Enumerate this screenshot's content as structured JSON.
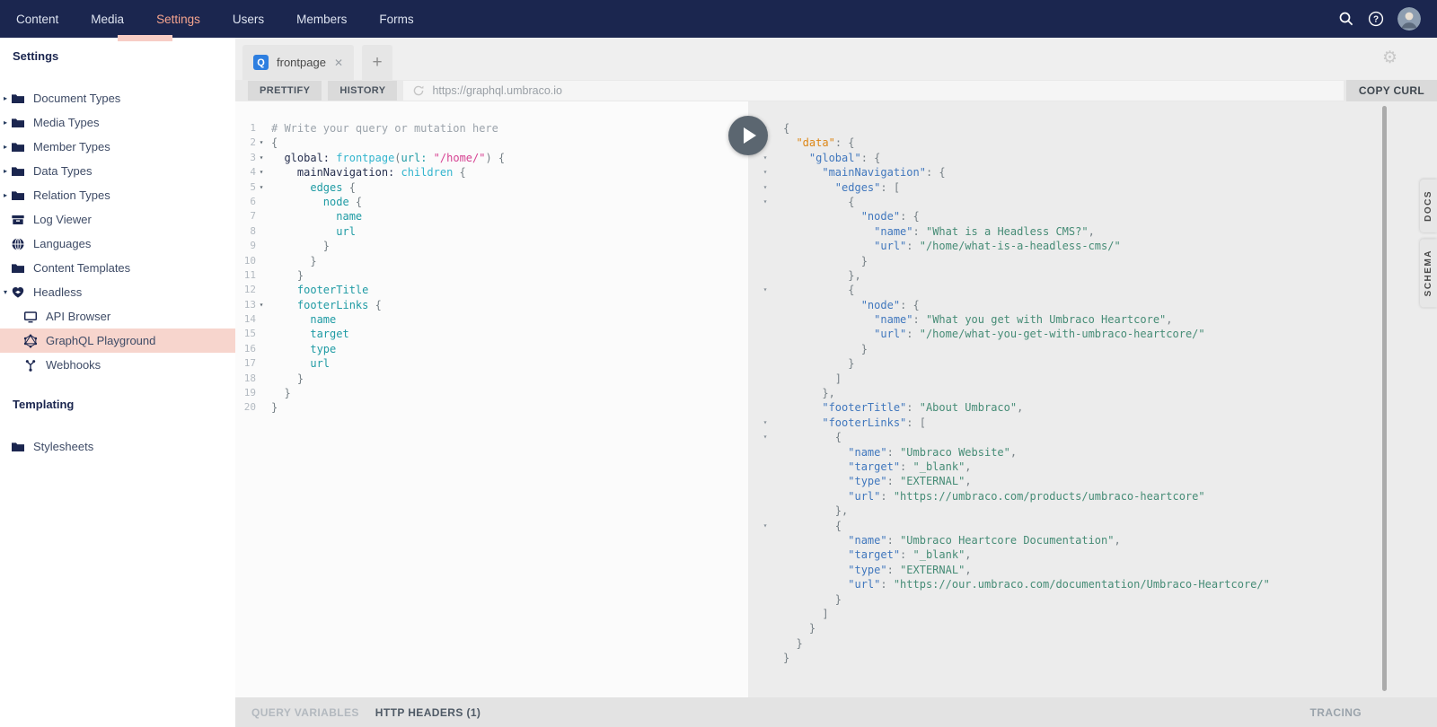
{
  "colors": {
    "header_navy": "#1b264f",
    "active_nav_salmon": "#f5a48e",
    "selection_pink": "#f7d5cd",
    "tab_badge_blue": "#2e7fe0",
    "play_button": "#5b6670",
    "query_field_cyan": "#33b5ce",
    "query_string_pink": "#d64292",
    "response_key_blue": "#4077bd",
    "response_data_orange": "#dd8615",
    "response_value_green": "#468c76"
  },
  "topnav": {
    "items": [
      {
        "label": "Content",
        "active": false
      },
      {
        "label": "Media",
        "active": false
      },
      {
        "label": "Settings",
        "active": true
      },
      {
        "label": "Users",
        "active": false
      },
      {
        "label": "Members",
        "active": false
      },
      {
        "label": "Forms",
        "active": false
      }
    ]
  },
  "sidebar": {
    "sections": [
      {
        "heading": "Settings",
        "items": [
          {
            "label": "Document Types",
            "icon": "folder",
            "arrow": "right",
            "child": false,
            "selected": false
          },
          {
            "label": "Media Types",
            "icon": "folder",
            "arrow": "right",
            "child": false,
            "selected": false
          },
          {
            "label": "Member Types",
            "icon": "folder",
            "arrow": "right",
            "child": false,
            "selected": false
          },
          {
            "label": "Data Types",
            "icon": "folder",
            "arrow": "right",
            "child": false,
            "selected": false
          },
          {
            "label": "Relation Types",
            "icon": "folder",
            "arrow": "right",
            "child": false,
            "selected": false
          },
          {
            "label": "Log Viewer",
            "icon": "archive",
            "arrow": null,
            "child": false,
            "selected": false
          },
          {
            "label": "Languages",
            "icon": "globe",
            "arrow": null,
            "child": false,
            "selected": false
          },
          {
            "label": "Content Templates",
            "icon": "folder",
            "arrow": null,
            "child": false,
            "selected": false
          },
          {
            "label": "Headless",
            "icon": "heart",
            "arrow": "down",
            "child": false,
            "selected": false
          },
          {
            "label": "API Browser",
            "icon": "monitor",
            "arrow": null,
            "child": true,
            "selected": false
          },
          {
            "label": "GraphQL Playground",
            "icon": "graphql",
            "arrow": null,
            "child": true,
            "selected": true
          },
          {
            "label": "Webhooks",
            "icon": "webhook",
            "arrow": null,
            "child": true,
            "selected": false
          }
        ]
      },
      {
        "heading": "Templating",
        "items": [
          {
            "label": "Stylesheets",
            "icon": "folder",
            "arrow": null,
            "child": false,
            "selected": false
          }
        ]
      }
    ]
  },
  "playground": {
    "tab": {
      "badge": "Q",
      "label": "frontpage",
      "close_glyph": "✕"
    },
    "new_tab_glyph": "+",
    "toolbar": {
      "prettify": "PRETTIFY",
      "history": "HISTORY",
      "url": "https://graphql.umbraco.io",
      "copy_curl": "COPY CURL"
    },
    "side_tabs": [
      "DOCS",
      "SCHEMA"
    ],
    "bottom": {
      "query_variables": "QUERY VARIABLES",
      "http_headers": "HTTP HEADERS (1)",
      "tracing": "TRACING"
    },
    "query_lines": [
      {
        "n": 1,
        "ind": 0,
        "fold": false,
        "tk": [
          [
            "c",
            "# Write your query or mutation here"
          ]
        ]
      },
      {
        "n": 2,
        "ind": 0,
        "fold": true,
        "tk": [
          [
            "p",
            "{"
          ]
        ]
      },
      {
        "n": 3,
        "ind": 2,
        "fold": true,
        "tk": [
          [
            "a",
            "global:"
          ],
          [
            "p",
            " "
          ],
          [
            "f",
            "frontpage"
          ],
          [
            "p",
            "("
          ],
          [
            "t",
            "url:"
          ],
          [
            "p",
            " "
          ],
          [
            "s",
            "\"/home/\""
          ],
          [
            "p",
            ") {"
          ]
        ]
      },
      {
        "n": 4,
        "ind": 4,
        "fold": true,
        "tk": [
          [
            "a",
            "mainNavigation:"
          ],
          [
            "p",
            " "
          ],
          [
            "f",
            "children"
          ],
          [
            "p",
            " {"
          ]
        ]
      },
      {
        "n": 5,
        "ind": 6,
        "fold": true,
        "tk": [
          [
            "t",
            "edges"
          ],
          [
            "p",
            " {"
          ]
        ]
      },
      {
        "n": 6,
        "ind": 8,
        "fold": false,
        "tk": [
          [
            "t",
            "node"
          ],
          [
            "p",
            " {"
          ]
        ]
      },
      {
        "n": 7,
        "ind": 10,
        "fold": false,
        "tk": [
          [
            "t",
            "name"
          ]
        ]
      },
      {
        "n": 8,
        "ind": 10,
        "fold": false,
        "tk": [
          [
            "t",
            "url"
          ]
        ]
      },
      {
        "n": 9,
        "ind": 8,
        "fold": false,
        "tk": [
          [
            "p",
            "}"
          ]
        ]
      },
      {
        "n": 10,
        "ind": 6,
        "fold": false,
        "tk": [
          [
            "p",
            "}"
          ]
        ]
      },
      {
        "n": 11,
        "ind": 4,
        "fold": false,
        "tk": [
          [
            "p",
            "}"
          ]
        ]
      },
      {
        "n": 12,
        "ind": 4,
        "fold": false,
        "tk": [
          [
            "t",
            "footerTitle"
          ]
        ]
      },
      {
        "n": 13,
        "ind": 4,
        "fold": true,
        "tk": [
          [
            "t",
            "footerLinks"
          ],
          [
            "p",
            " {"
          ]
        ]
      },
      {
        "n": 14,
        "ind": 6,
        "fold": false,
        "tk": [
          [
            "t",
            "name"
          ]
        ]
      },
      {
        "n": 15,
        "ind": 6,
        "fold": false,
        "tk": [
          [
            "t",
            "target"
          ]
        ]
      },
      {
        "n": 16,
        "ind": 6,
        "fold": false,
        "tk": [
          [
            "t",
            "type"
          ]
        ]
      },
      {
        "n": 17,
        "ind": 6,
        "fold": false,
        "tk": [
          [
            "t",
            "url"
          ]
        ]
      },
      {
        "n": 18,
        "ind": 4,
        "fold": false,
        "tk": [
          [
            "p",
            "}"
          ]
        ]
      },
      {
        "n": 19,
        "ind": 2,
        "fold": false,
        "tk": [
          [
            "p",
            "}"
          ]
        ]
      },
      {
        "n": 20,
        "ind": 0,
        "fold": false,
        "tk": [
          [
            "p",
            "}"
          ]
        ]
      }
    ],
    "response_lines": [
      {
        "ind": 0,
        "fold": true,
        "tk": [
          [
            "p",
            "{"
          ]
        ]
      },
      {
        "ind": 2,
        "fold": true,
        "tk": [
          [
            "d",
            "\"data\""
          ],
          [
            "p",
            ": {"
          ]
        ]
      },
      {
        "ind": 4,
        "fold": true,
        "tk": [
          [
            "k",
            "\"global\""
          ],
          [
            "p",
            ": {"
          ]
        ]
      },
      {
        "ind": 6,
        "fold": true,
        "tk": [
          [
            "k",
            "\"mainNavigation\""
          ],
          [
            "p",
            ": {"
          ]
        ]
      },
      {
        "ind": 8,
        "fold": true,
        "tk": [
          [
            "k",
            "\"edges\""
          ],
          [
            "p",
            ": ["
          ]
        ]
      },
      {
        "ind": 10,
        "fold": true,
        "tk": [
          [
            "p",
            "{"
          ]
        ]
      },
      {
        "ind": 12,
        "fold": false,
        "tk": [
          [
            "k",
            "\"node\""
          ],
          [
            "p",
            ": {"
          ]
        ]
      },
      {
        "ind": 14,
        "fold": false,
        "tk": [
          [
            "k",
            "\"name\""
          ],
          [
            "p",
            ": "
          ],
          [
            "v",
            "\"What is a Headless CMS?\""
          ],
          [
            "p",
            ","
          ]
        ]
      },
      {
        "ind": 14,
        "fold": false,
        "tk": [
          [
            "k",
            "\"url\""
          ],
          [
            "p",
            ": "
          ],
          [
            "v",
            "\"/home/what-is-a-headless-cms/\""
          ]
        ]
      },
      {
        "ind": 12,
        "fold": false,
        "tk": [
          [
            "p",
            "}"
          ]
        ]
      },
      {
        "ind": 10,
        "fold": false,
        "tk": [
          [
            "p",
            "},"
          ]
        ]
      },
      {
        "ind": 10,
        "fold": true,
        "tk": [
          [
            "p",
            "{"
          ]
        ]
      },
      {
        "ind": 12,
        "fold": false,
        "tk": [
          [
            "k",
            "\"node\""
          ],
          [
            "p",
            ": {"
          ]
        ]
      },
      {
        "ind": 14,
        "fold": false,
        "tk": [
          [
            "k",
            "\"name\""
          ],
          [
            "p",
            ": "
          ],
          [
            "v",
            "\"What you get with Umbraco Heartcore\""
          ],
          [
            "p",
            ","
          ]
        ]
      },
      {
        "ind": 14,
        "fold": false,
        "tk": [
          [
            "k",
            "\"url\""
          ],
          [
            "p",
            ": "
          ],
          [
            "v",
            "\"/home/what-you-get-with-umbraco-heartcore/\""
          ]
        ]
      },
      {
        "ind": 12,
        "fold": false,
        "tk": [
          [
            "p",
            "}"
          ]
        ]
      },
      {
        "ind": 10,
        "fold": false,
        "tk": [
          [
            "p",
            "}"
          ]
        ]
      },
      {
        "ind": 8,
        "fold": false,
        "tk": [
          [
            "p",
            "]"
          ]
        ]
      },
      {
        "ind": 6,
        "fold": false,
        "tk": [
          [
            "p",
            "},"
          ]
        ]
      },
      {
        "ind": 6,
        "fold": false,
        "tk": [
          [
            "k",
            "\"footerTitle\""
          ],
          [
            "p",
            ": "
          ],
          [
            "v",
            "\"About Umbraco\""
          ],
          [
            "p",
            ","
          ]
        ]
      },
      {
        "ind": 6,
        "fold": true,
        "tk": [
          [
            "k",
            "\"footerLinks\""
          ],
          [
            "p",
            ": ["
          ]
        ]
      },
      {
        "ind": 8,
        "fold": true,
        "tk": [
          [
            "p",
            "{"
          ]
        ]
      },
      {
        "ind": 10,
        "fold": false,
        "tk": [
          [
            "k",
            "\"name\""
          ],
          [
            "p",
            ": "
          ],
          [
            "v",
            "\"Umbraco Website\""
          ],
          [
            "p",
            ","
          ]
        ]
      },
      {
        "ind": 10,
        "fold": false,
        "tk": [
          [
            "k",
            "\"target\""
          ],
          [
            "p",
            ": "
          ],
          [
            "v",
            "\"_blank\""
          ],
          [
            "p",
            ","
          ]
        ]
      },
      {
        "ind": 10,
        "fold": false,
        "tk": [
          [
            "k",
            "\"type\""
          ],
          [
            "p",
            ": "
          ],
          [
            "v",
            "\"EXTERNAL\""
          ],
          [
            "p",
            ","
          ]
        ]
      },
      {
        "ind": 10,
        "fold": false,
        "tk": [
          [
            "k",
            "\"url\""
          ],
          [
            "p",
            ": "
          ],
          [
            "v",
            "\"https://umbraco.com/products/umbraco-heartcore\""
          ]
        ]
      },
      {
        "ind": 8,
        "fold": false,
        "tk": [
          [
            "p",
            "},"
          ]
        ]
      },
      {
        "ind": 8,
        "fold": true,
        "tk": [
          [
            "p",
            "{"
          ]
        ]
      },
      {
        "ind": 10,
        "fold": false,
        "tk": [
          [
            "k",
            "\"name\""
          ],
          [
            "p",
            ": "
          ],
          [
            "v",
            "\"Umbraco Heartcore Documentation\""
          ],
          [
            "p",
            ","
          ]
        ]
      },
      {
        "ind": 10,
        "fold": false,
        "tk": [
          [
            "k",
            "\"target\""
          ],
          [
            "p",
            ": "
          ],
          [
            "v",
            "\"_blank\""
          ],
          [
            "p",
            ","
          ]
        ]
      },
      {
        "ind": 10,
        "fold": false,
        "tk": [
          [
            "k",
            "\"type\""
          ],
          [
            "p",
            ": "
          ],
          [
            "v",
            "\"EXTERNAL\""
          ],
          [
            "p",
            ","
          ]
        ]
      },
      {
        "ind": 10,
        "fold": false,
        "tk": [
          [
            "k",
            "\"url\""
          ],
          [
            "p",
            ": "
          ],
          [
            "v",
            "\"https://our.umbraco.com/documentation/Umbraco-Heartcore/\""
          ]
        ]
      },
      {
        "ind": 8,
        "fold": false,
        "tk": [
          [
            "p",
            "}"
          ]
        ]
      },
      {
        "ind": 6,
        "fold": false,
        "tk": [
          [
            "p",
            "]"
          ]
        ]
      },
      {
        "ind": 4,
        "fold": false,
        "tk": [
          [
            "p",
            "}"
          ]
        ]
      },
      {
        "ind": 2,
        "fold": false,
        "tk": [
          [
            "p",
            "}"
          ]
        ]
      },
      {
        "ind": 0,
        "fold": false,
        "tk": [
          [
            "p",
            "}"
          ]
        ]
      }
    ]
  }
}
